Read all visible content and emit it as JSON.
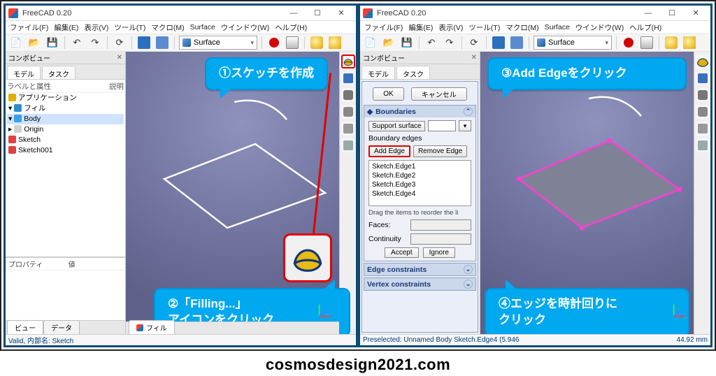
{
  "app": {
    "title": "FreeCAD 0.20",
    "menus": [
      "ファイル(F)",
      "編集(E)",
      "表示(V)",
      "ツール(T)",
      "マクロ(M)",
      "Surface",
      "ウインドウ(W)",
      "ヘルプ(H)"
    ],
    "workbench": "Surface",
    "min_label": "—",
    "max_label": "☐",
    "close_label": "✕"
  },
  "left": {
    "panel_title": "コンボビュー",
    "tabs": {
      "model": "モデル",
      "task": "タスク"
    },
    "tree": {
      "hdr_label": "ラベルと属性",
      "hdr_desc": "説明",
      "app": "アプリケーション",
      "fill": "フィル",
      "body": "Body",
      "origin": "Origin",
      "sketch": "Sketch",
      "sketch001": "Sketch001"
    },
    "prop": {
      "col_prop": "プロパティ",
      "col_val": "値"
    },
    "bottom_tabs": {
      "view": "ビュー",
      "data": "データ"
    },
    "doctab": "フィル",
    "status": "Valid, 内部名: Sketch"
  },
  "right": {
    "tabs": {
      "model": "モデル",
      "task": "タスク"
    },
    "task": {
      "ok": "OK",
      "cancel": "キャンセル",
      "boundaries": "Boundaries",
      "support": "Support surface",
      "bedges": "Boundary edges",
      "add_edge": "Add Edge",
      "remove_edge": "Remove Edge",
      "edges": [
        "Sketch.Edge1",
        "Sketch.Edge2",
        "Sketch.Edge3",
        "Sketch.Edge4"
      ],
      "reorder": "Drag the items to reorder the li",
      "faces": "Faces:",
      "continuity": "Continuity",
      "accept": "Accept",
      "ignore": "Ignore",
      "edge_constraints": "Edge constraints",
      "vertex_constraints": "Vertex constraints"
    },
    "status": "Preselected: Unnamed Body Sketch.Edge4 (5.946",
    "status_dim": "44.92 mm"
  },
  "callouts": {
    "c1": "①スケッチを作成",
    "c2_l1": "②「Filling...」",
    "c2_l2": "アイコンをクリック",
    "c3": "③Add Edgeをクリック",
    "c4_l1": "④エッジを時計回りに",
    "c4_l2": "クリック"
  },
  "footer": "cosmosdesign2021.com"
}
